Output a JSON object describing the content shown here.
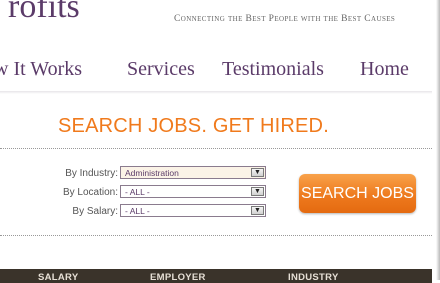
{
  "header": {
    "logo_fragment": "rofits",
    "tagline": "Connecting the Best People with the Best Causes"
  },
  "nav": {
    "items": [
      {
        "label": "w It Works"
      },
      {
        "label": "Services"
      },
      {
        "label": "Testimonials"
      },
      {
        "label": "Home"
      }
    ]
  },
  "search": {
    "heading": "SEARCH JOBS. GET HIRED.",
    "industry_label": "By Industry:",
    "industry_value": "Administration",
    "location_label": "By Location:",
    "location_value": "- ALL -",
    "salary_label": "By Salary:",
    "salary_value": "- ALL -",
    "button_label": "SEARCH JOBS"
  },
  "table": {
    "columns": [
      "SALARY",
      "EMPLOYER",
      "INDUSTRY"
    ]
  },
  "colors": {
    "brand_purple": "#5b3b69",
    "accent_orange": "#f07a1c",
    "table_header_bg": "#3a332a"
  }
}
